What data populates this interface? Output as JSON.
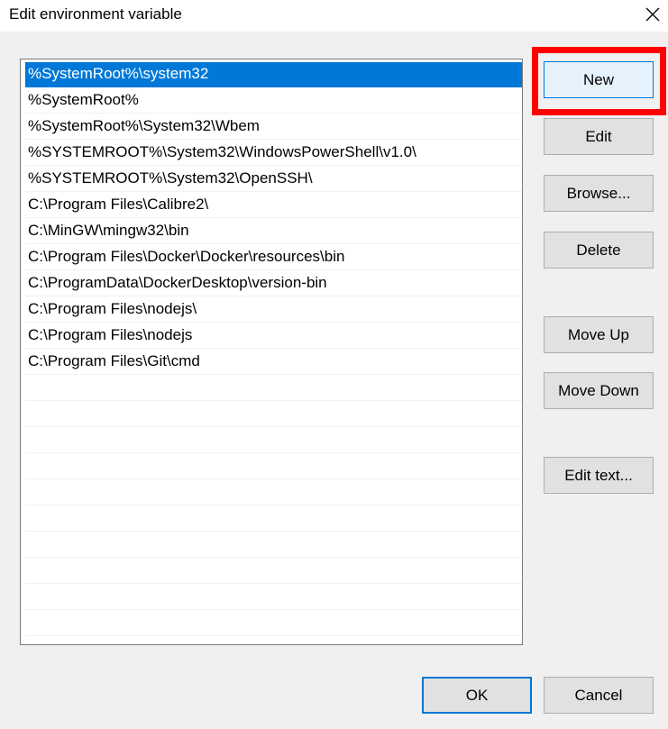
{
  "window": {
    "title": "Edit environment variable",
    "close_icon": "close-icon"
  },
  "path_entries": [
    "%SystemRoot%\\system32",
    "%SystemRoot%",
    "%SystemRoot%\\System32\\Wbem",
    "%SYSTEMROOT%\\System32\\WindowsPowerShell\\v1.0\\",
    "%SYSTEMROOT%\\System32\\OpenSSH\\",
    "C:\\Program Files\\Calibre2\\",
    "C:\\MinGW\\mingw32\\bin",
    "C:\\Program Files\\Docker\\Docker\\resources\\bin",
    "C:\\ProgramData\\DockerDesktop\\version-bin",
    "C:\\Program Files\\nodejs\\",
    "C:\\Program Files\\nodejs",
    "C:\\Program Files\\Git\\cmd"
  ],
  "selected_index": 0,
  "buttons": {
    "new": "New",
    "edit": "Edit",
    "browse": "Browse...",
    "delete": "Delete",
    "move_up": "Move Up",
    "move_down": "Move Down",
    "edit_text": "Edit text..."
  },
  "footer": {
    "ok": "OK",
    "cancel": "Cancel"
  },
  "colors": {
    "selection": "#0078d7",
    "highlight": "#ff0000",
    "dialog_bg": "#f0f0f0"
  }
}
